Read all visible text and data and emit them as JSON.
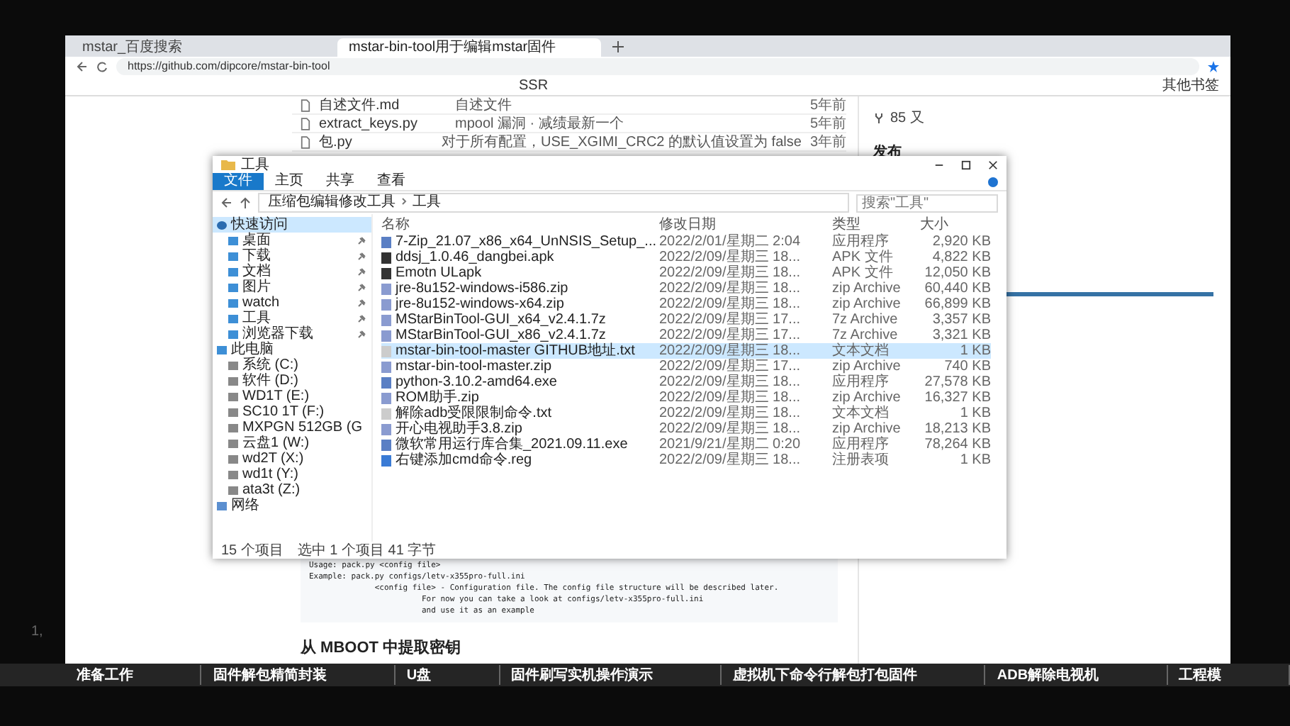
{
  "browser": {
    "tabs": [
      {
        "title": "mstar_百度搜索",
        "selected": false
      },
      {
        "title": "mstar-bin-tool用于编辑mstar固件",
        "selected": true
      }
    ],
    "url": "https://github.com/dipcore/mstar-bin-tool",
    "bookmarks": [
      "SSR"
    ],
    "other_bookmarks": "其他书签"
  },
  "repo_files": [
    {
      "name": "自述文件.md",
      "message": "自述文件",
      "age": "5年前"
    },
    {
      "name": "extract_keys.py",
      "message": "mpool 漏洞 · 减绩最新一个",
      "age": "5年前"
    },
    {
      "name": "包.py",
      "message": "对于所有配置，USE_XGIMI_CRC2 的默认值设置为 false",
      "age": "3年前"
    }
  ],
  "sidebar": {
    "stars": "85 又",
    "releases_heading": "发布"
  },
  "code_block": [
    "Usage: pack.py <config file>",
    "Example: pack.py configs/letv-x355pro-full.ini",
    "              <config file> - Configuration file. The config file structure will be described later.",
    "                        For now you can take a look at configs/letv-x355pro-full.ini",
    "                        and use it as an example"
  ],
  "section_heading": "从 MBOOT 中提取密钥",
  "explorer": {
    "title": "工具",
    "ribbon_tabs": [
      {
        "label": "文件",
        "kind": "menu"
      },
      {
        "label": "主页",
        "kind": "tab"
      },
      {
        "label": "共享",
        "kind": "tab"
      },
      {
        "label": "查看",
        "kind": "tab"
      }
    ],
    "breadcrumb": [
      "压缩包编辑修改工具",
      "工具"
    ],
    "search": {
      "placeholder": "搜索\"工具\""
    },
    "nav": [
      {
        "label": "快速访问",
        "kind": "star",
        "selected": true,
        "children": [
          {
            "label": "桌面",
            "kind": "folder",
            "pinned": true
          },
          {
            "label": "下载",
            "kind": "folder",
            "pinned": true
          },
          {
            "label": "文档",
            "kind": "folder",
            "pinned": true
          },
          {
            "label": "图片",
            "kind": "folder",
            "pinned": true
          },
          {
            "label": "watch",
            "kind": "folder",
            "pinned": true
          },
          {
            "label": "工具",
            "kind": "folder",
            "pinned": true
          },
          {
            "label": "浏览器下载",
            "kind": "folder",
            "pinned": true
          }
        ]
      },
      {
        "label": "此电脑",
        "kind": "pc",
        "selected": false,
        "children": [
          {
            "label": "系统 (C:)",
            "kind": "drive",
            "pinned": false
          },
          {
            "label": "软件 (D:)",
            "kind": "drive",
            "pinned": false
          },
          {
            "label": "WD1T (E:)",
            "kind": "drive",
            "pinned": false
          },
          {
            "label": "SC10 1T (F:)",
            "kind": "drive",
            "pinned": false
          },
          {
            "label": "MXPGN 512GB (G",
            "kind": "drive",
            "pinned": false
          },
          {
            "label": "云盘1 (W:)",
            "kind": "drive",
            "pinned": false
          },
          {
            "label": "wd2T (X:)",
            "kind": "drive",
            "pinned": false
          },
          {
            "label": "wd1t (Y:)",
            "kind": "drive",
            "pinned": false
          },
          {
            "label": "ata3t (Z:)",
            "kind": "drive",
            "pinned": false
          }
        ]
      },
      {
        "label": "网络",
        "kind": "network",
        "selected": false
      }
    ],
    "columns": [
      "名称",
      "修改日期",
      "类型",
      "大小"
    ],
    "files": [
      {
        "name": "7-Zip_21.07_x86_x64_UnNSIS_Setup_...",
        "date": "2022/2/01/星期二 2:04",
        "type": "应用程序",
        "size": "2,920 KB",
        "kind": "exe",
        "selected": false
      },
      {
        "name": "ddsj_1.0.46_dangbei.apk",
        "date": "2022/2/09/星期三 18...",
        "type": "APK 文件",
        "size": "4,822 KB",
        "kind": "apk",
        "selected": false
      },
      {
        "name": "Emotn ULapk",
        "date": "2022/2/09/星期三 18...",
        "type": "APK 文件",
        "size": "12,050 KB",
        "kind": "apk",
        "selected": false
      },
      {
        "name": "jre-8u152-windows-i586.zip",
        "date": "2022/2/09/星期三 18...",
        "type": "zip Archive",
        "size": "60,440 KB",
        "kind": "zip",
        "selected": false
      },
      {
        "name": "jre-8u152-windows-x64.zip",
        "date": "2022/2/09/星期三 18...",
        "type": "zip Archive",
        "size": "66,899 KB",
        "kind": "zip",
        "selected": false
      },
      {
        "name": "MStarBinTool-GUI_x64_v2.4.1.7z",
        "date": "2022/2/09/星期三 17...",
        "type": "7z Archive",
        "size": "3,357 KB",
        "kind": "zip",
        "selected": false
      },
      {
        "name": "MStarBinTool-GUI_x86_v2.4.1.7z",
        "date": "2022/2/09/星期三 17...",
        "type": "7z Archive",
        "size": "3,321 KB",
        "kind": "zip",
        "selected": false
      },
      {
        "name": "mstar-bin-tool-master GITHUB地址.txt",
        "date": "2022/2/09/星期三 18...",
        "type": "文本文档",
        "size": "1 KB",
        "kind": "txt",
        "selected": true
      },
      {
        "name": "mstar-bin-tool-master.zip",
        "date": "2022/2/09/星期三 17...",
        "type": "zip Archive",
        "size": "740 KB",
        "kind": "zip",
        "selected": false
      },
      {
        "name": "python-3.10.2-amd64.exe",
        "date": "2022/2/09/星期三 18...",
        "type": "应用程序",
        "size": "27,578 KB",
        "kind": "exe",
        "selected": false
      },
      {
        "name": "ROM助手.zip",
        "date": "2022/2/09/星期三 18...",
        "type": "zip Archive",
        "size": "16,327 KB",
        "kind": "zip",
        "selected": false
      },
      {
        "name": "解除adb受限限制命令.txt",
        "date": "2022/2/09/星期三 18...",
        "type": "文本文档",
        "size": "1 KB",
        "kind": "txt",
        "selected": false
      },
      {
        "name": "开心电视助手3.8.zip",
        "date": "2022/2/09/星期三 18...",
        "type": "zip Archive",
        "size": "18,213 KB",
        "kind": "zip",
        "selected": false
      },
      {
        "name": "微软常用运行库合集_2021.09.11.exe",
        "date": "2021/9/21/星期二 0:20",
        "type": "应用程序",
        "size": "78,264 KB",
        "kind": "exe",
        "selected": false
      },
      {
        "name": "右键添加cmd命令.reg",
        "date": "2022/2/09/星期三 18...",
        "type": "注册表项",
        "size": "1 KB",
        "kind": "reg",
        "selected": false
      }
    ],
    "status": {
      "count": "15 个项目",
      "selection": "选中 1 个项目 41 字节"
    }
  },
  "player": {
    "viewer_count": "1,",
    "chapters": [
      "准备工作",
      "固件解包精简封装",
      "U盘",
      "固件刷写实机操作演示",
      "虚拟机下命令行解包打包固件",
      "ADB解除电视机",
      "工程模"
    ]
  }
}
